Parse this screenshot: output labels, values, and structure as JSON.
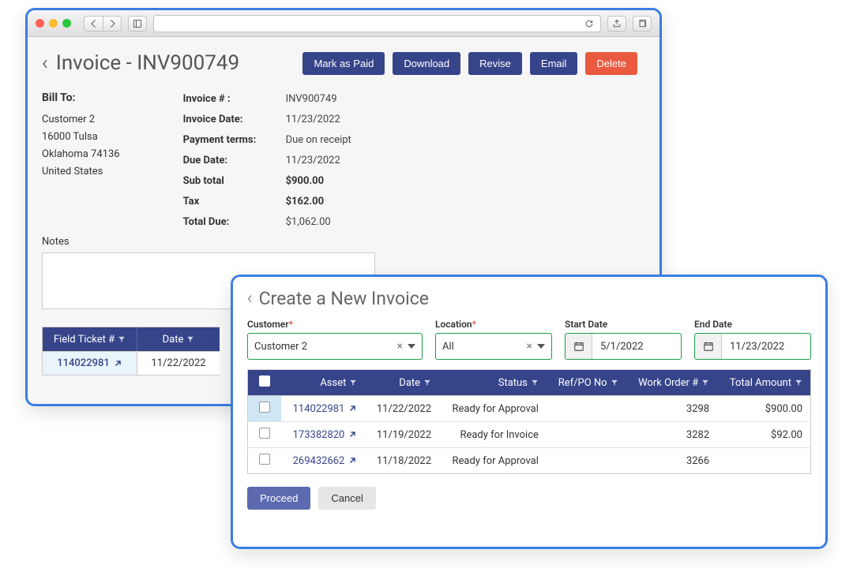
{
  "invoice": {
    "title": "Invoice - INV900749",
    "buttons": {
      "mark_paid": "Mark as Paid",
      "download": "Download",
      "revise": "Revise",
      "email": "Email",
      "delete": "Delete"
    },
    "bill_to_label": "Bill To:",
    "bill_to": {
      "name": "Customer 2",
      "street": "16000 Tulsa",
      "city_state_zip": "Oklahoma 74136",
      "country": "United States"
    },
    "meta": {
      "invoice_no_label": "Invoice # :",
      "invoice_no": "INV900749",
      "invoice_date_label": "Invoice Date:",
      "invoice_date": "11/23/2022",
      "payment_terms_label": "Payment terms:",
      "payment_terms": "Due on receipt",
      "due_date_label": "Due Date:",
      "due_date": "11/23/2022",
      "subtotal_label": "Sub total",
      "subtotal": "$900.00",
      "tax_label": "Tax",
      "tax": "$162.00",
      "total_due_label": "Total Due:",
      "total_due": "$1,062.00"
    },
    "notes_label": "Notes",
    "mini_table": {
      "headers": {
        "field_ticket": "Field Ticket #",
        "date": "Date"
      },
      "row": {
        "ticket": "114022981",
        "date": "11/22/2022"
      }
    }
  },
  "create": {
    "title": "Create a New Invoice",
    "labels": {
      "customer": "Customer",
      "location": "Location",
      "start_date": "Start Date",
      "end_date": "End Date"
    },
    "values": {
      "customer": "Customer 2",
      "location": "All",
      "start_date": "5/1/2022",
      "end_date": "11/23/2022"
    },
    "table": {
      "headers": {
        "asset": "Asset",
        "date": "Date",
        "status": "Status",
        "refpo": "Ref/PO No",
        "work_order": "Work Order #",
        "total": "Total Amount"
      },
      "rows": [
        {
          "asset": "114022981",
          "date": "11/22/2022",
          "status": "Ready for Approval",
          "refpo": "",
          "work_order": "3298",
          "total": "$900.00",
          "hi": true
        },
        {
          "asset": "173382820",
          "date": "11/19/2022",
          "status": "Ready for Invoice",
          "refpo": "",
          "work_order": "3282",
          "total": "$92.00",
          "hi": false
        },
        {
          "asset": "269432662",
          "date": "11/18/2022",
          "status": "Ready for Approval",
          "refpo": "",
          "work_order": "3266",
          "total": "",
          "hi": false
        }
      ]
    },
    "actions": {
      "proceed": "Proceed",
      "cancel": "Cancel"
    }
  }
}
